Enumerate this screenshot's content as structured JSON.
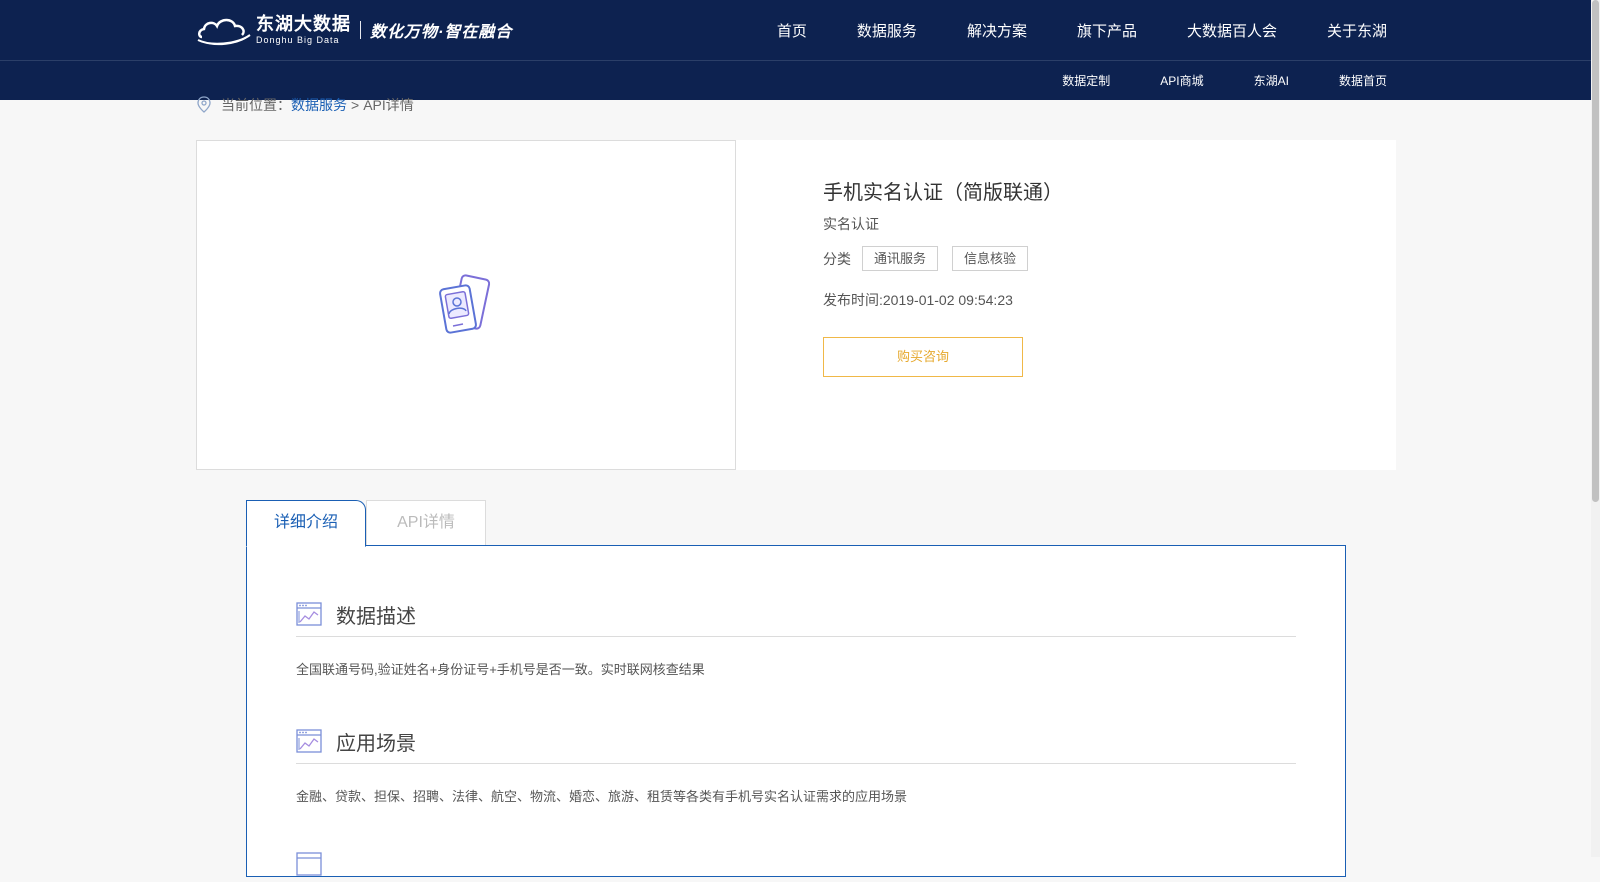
{
  "header": {
    "logo": {
      "name": "东湖大数据",
      "en_name": "Donghu Big Data",
      "slogan": "数化万物·智在融合"
    },
    "main_nav": [
      "首页",
      "数据服务",
      "解决方案",
      "旗下产品",
      "大数据百人会",
      "关于东湖"
    ],
    "sub_nav": [
      "数据定制",
      "API商城",
      "东湖AI",
      "数据首页"
    ]
  },
  "breadcrumb": {
    "prefix": "当前位置：",
    "link": "数据服务",
    "separator": ">",
    "current": "API详情"
  },
  "product": {
    "title": "手机实名认证（简版联通）",
    "subtitle": "实名认证",
    "category_label": "分类",
    "tags": [
      "通讯服务",
      "信息核验"
    ],
    "publish_time": "发布时间:2019-01-02 09:54:23",
    "buy_button": "购买咨询"
  },
  "tabs": [
    {
      "label": "详细介绍",
      "active": true
    },
    {
      "label": "API详情",
      "active": false
    }
  ],
  "sections": [
    {
      "title": "数据描述",
      "body": "全国联通号码,验证姓名+身份证号+手机号是否一致。实时联网核查结果"
    },
    {
      "title": "应用场景",
      "body": "金融、贷款、担保、招聘、法律、航空、物流、婚恋、旅游、租赁等各类有手机号实名认证需求的应用场景"
    }
  ],
  "colors": {
    "header_bg": "#0d2250",
    "accent_blue": "#1a5fb4",
    "buy_orange": "#e6a92e",
    "icon_purple": "#7b6fd8"
  },
  "icons": {
    "logo": "cloud-logo-icon",
    "breadcrumb": "location-pin-icon",
    "product": "id-card-phone-icon",
    "section": "chart-window-icon"
  }
}
